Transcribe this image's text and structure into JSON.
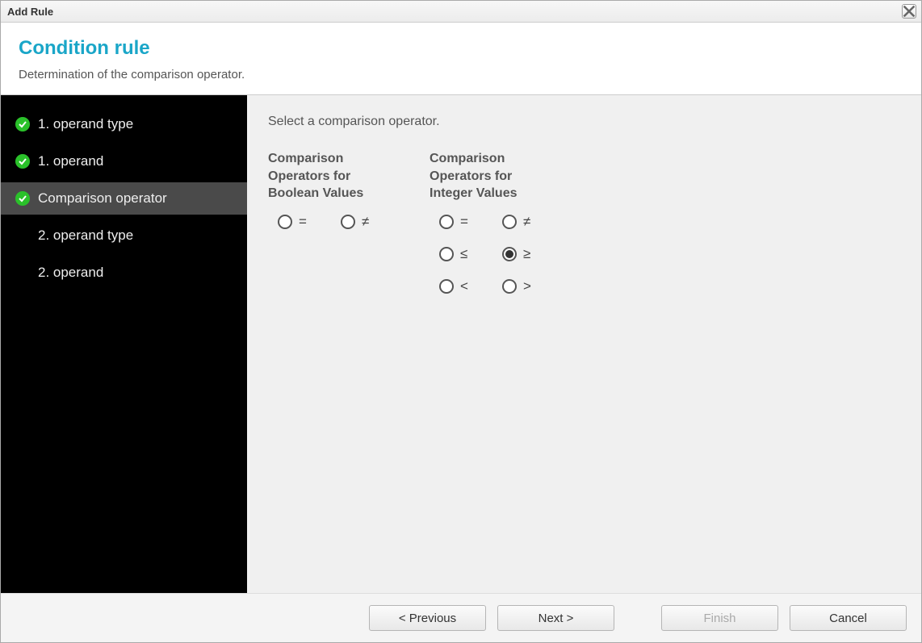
{
  "dialog": {
    "title": "Add Rule"
  },
  "header": {
    "title": "Condition rule",
    "subtitle": "Determination of the comparison operator."
  },
  "sidebar": {
    "items": [
      {
        "label": "1. operand type",
        "completed": true,
        "active": false
      },
      {
        "label": "1. operand",
        "completed": true,
        "active": false
      },
      {
        "label": "Comparison operator",
        "completed": true,
        "active": true
      },
      {
        "label": "2. operand type",
        "completed": false,
        "active": false
      },
      {
        "label": "2. operand",
        "completed": false,
        "active": false
      }
    ]
  },
  "content": {
    "instruction": "Select a comparison operator.",
    "groups": {
      "boolean": {
        "title": "Comparison Operators for Boolean Values",
        "options": [
          {
            "symbol": "=",
            "selected": false
          },
          {
            "symbol": "≠",
            "selected": false
          }
        ]
      },
      "integer": {
        "title": "Comparison Operators for Integer Values",
        "options": [
          {
            "symbol": "=",
            "selected": false
          },
          {
            "symbol": "≠",
            "selected": false
          },
          {
            "symbol": "≤",
            "selected": false
          },
          {
            "symbol": "≥",
            "selected": true
          },
          {
            "symbol": "<",
            "selected": false
          },
          {
            "symbol": ">",
            "selected": false
          }
        ]
      }
    }
  },
  "buttons": {
    "previous": "< Previous",
    "next": "Next >",
    "finish": "Finish",
    "cancel": "Cancel",
    "finish_enabled": false
  }
}
